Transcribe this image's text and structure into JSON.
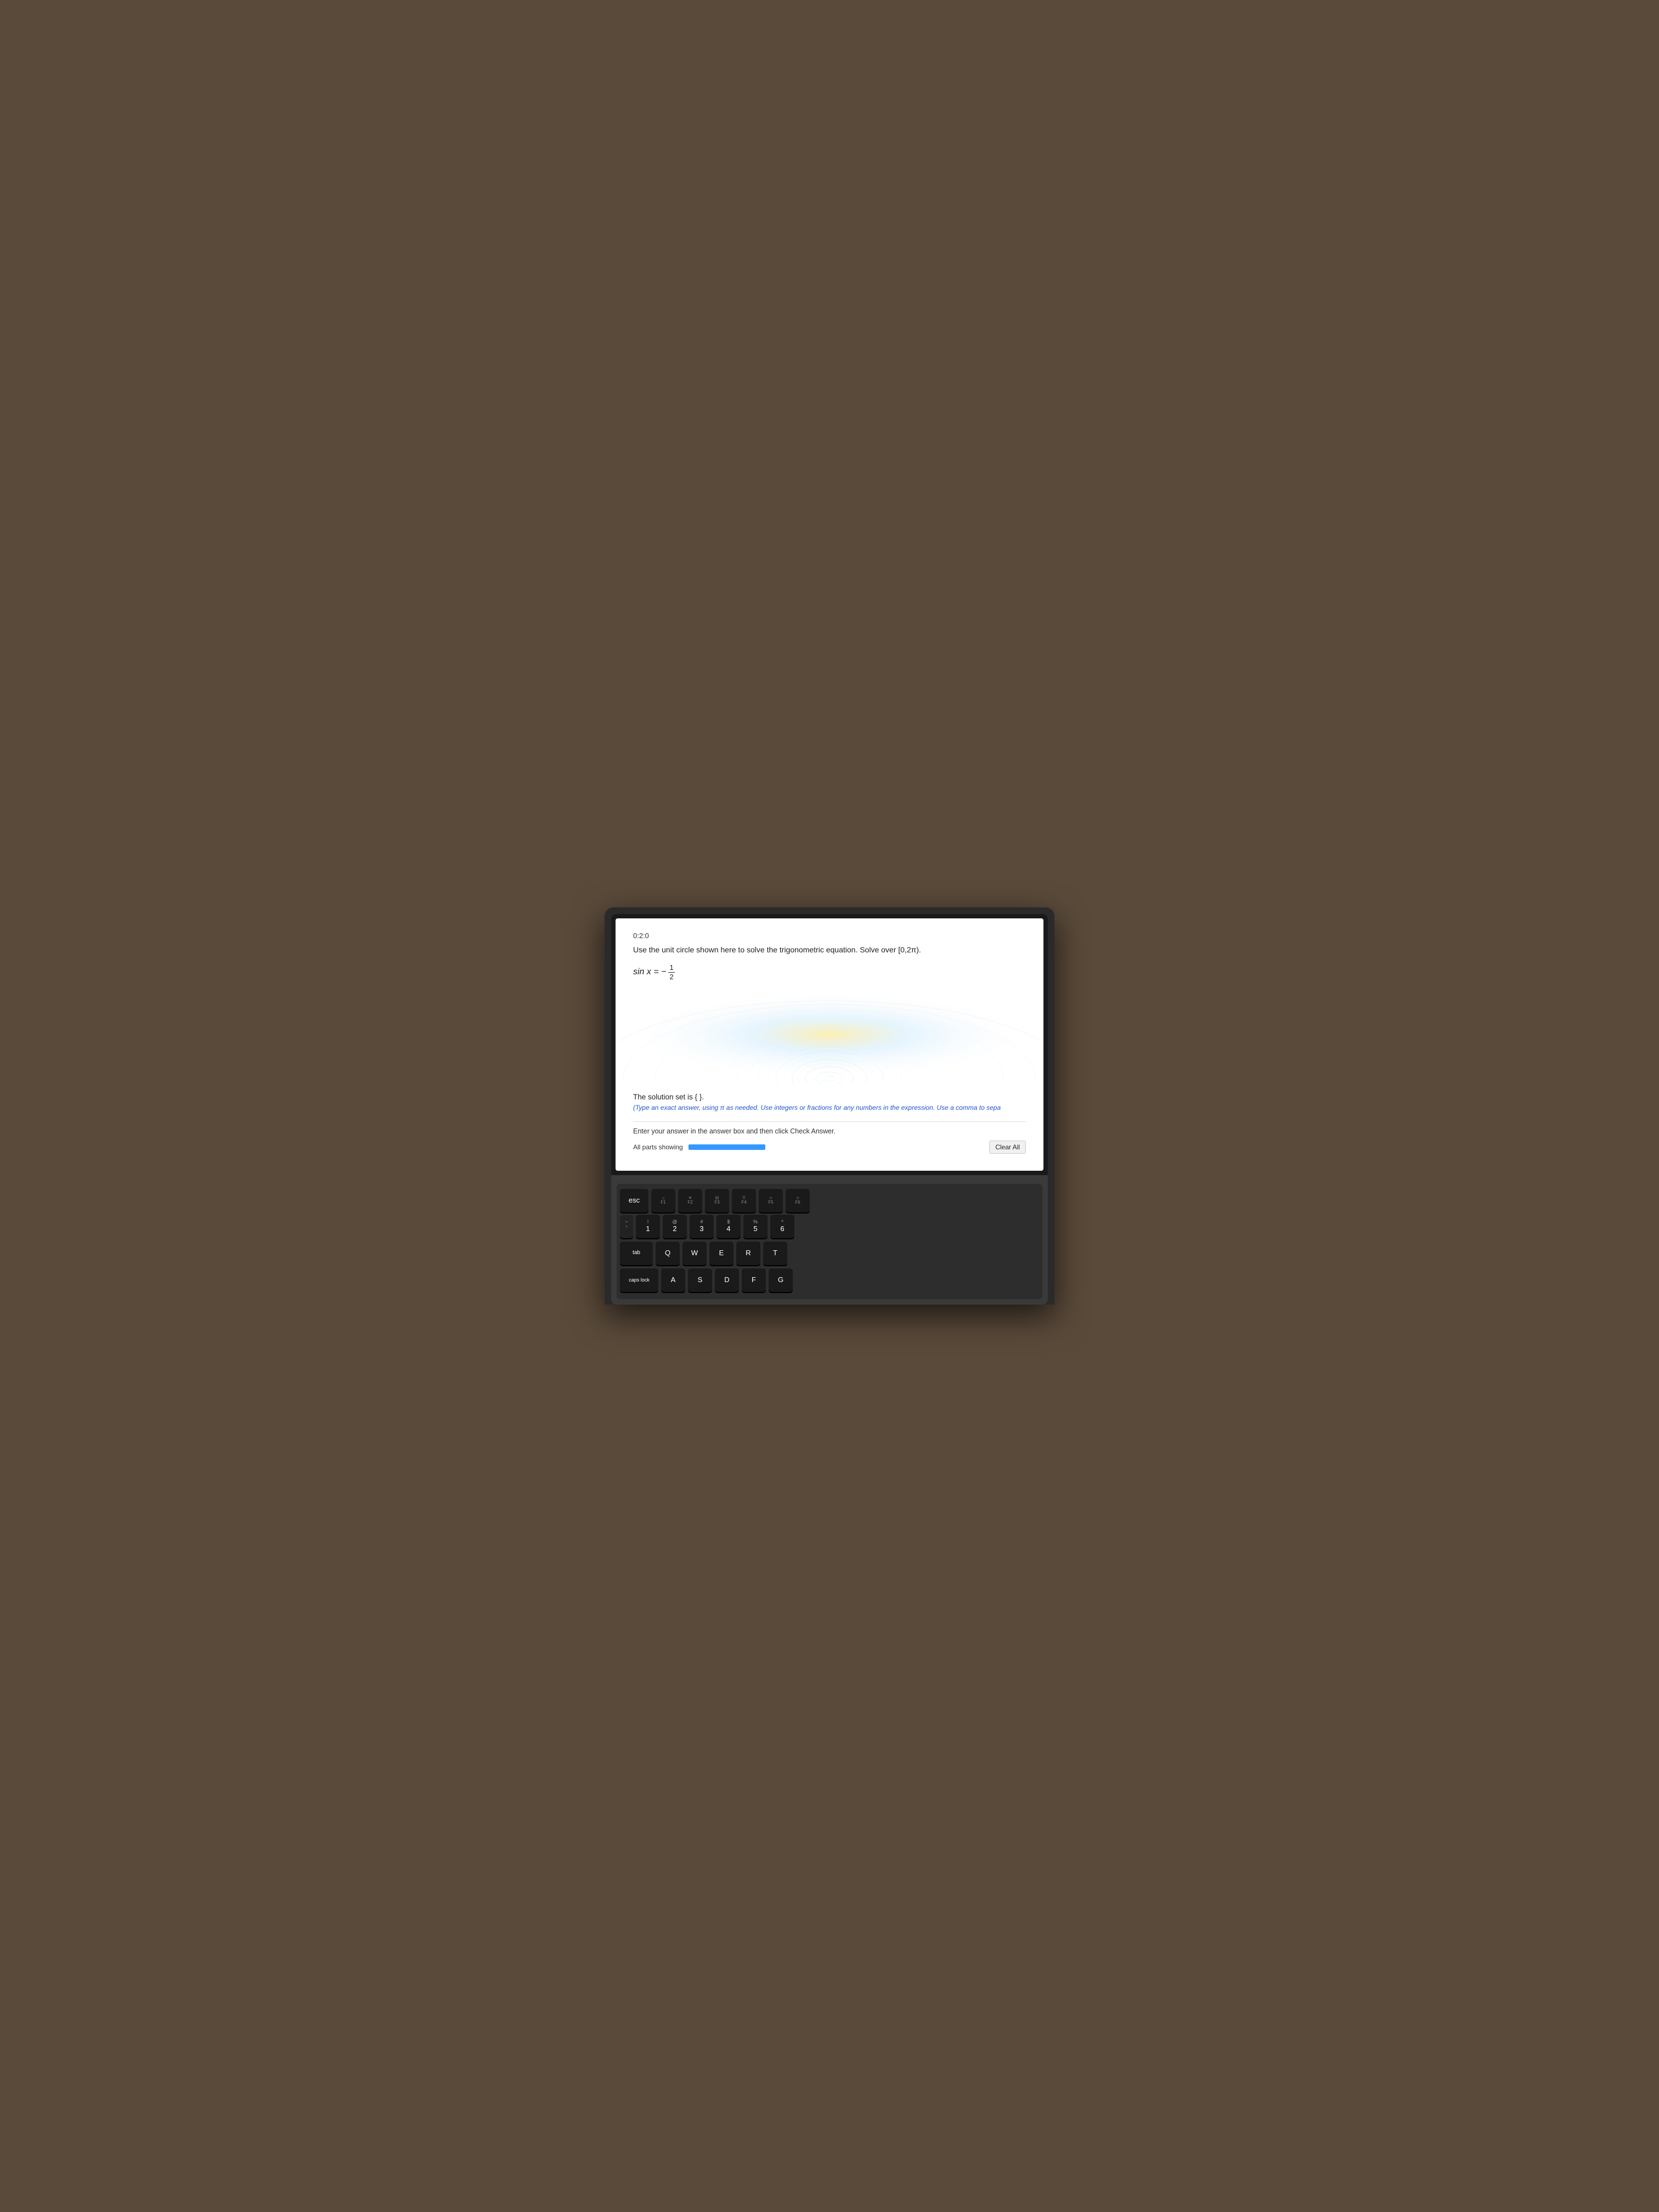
{
  "screen": {
    "problem_number": "0:2:0",
    "problem_text": "Use the unit circle shown here to solve the trigonometric equation. Solve over [0,2π).",
    "equation_prefix": "sin x = −",
    "equation_numerator": "1",
    "equation_denominator": "2",
    "solution_text": "The solution set is {    }.",
    "solution_instruction": "(Type an exact answer, using π as needed. Use integers or fractions for any numbers in the expression. Use a comma to sepa",
    "answer_instruction": "Enter your answer in the answer box and then click Check Answer.",
    "all_parts_label": "All parts showing",
    "clear_all_label": "Clear All"
  },
  "keyboard": {
    "fn_row": [
      {
        "label": "esc",
        "sub": ""
      },
      {
        "label": "F1",
        "sub": "☼"
      },
      {
        "label": "F2",
        "sub": "☀"
      },
      {
        "label": "F3",
        "sub": "⊞"
      },
      {
        "label": "F4",
        "sub": "⠿"
      },
      {
        "label": "F5",
        "sub": "⠶"
      },
      {
        "label": "F6",
        "sub": "⠶"
      }
    ],
    "number_row": [
      {
        "top": "~",
        "main": "`"
      },
      {
        "top": "!",
        "main": "1"
      },
      {
        "top": "@",
        "main": "2"
      },
      {
        "top": "#",
        "main": "3"
      },
      {
        "top": "$",
        "main": "4"
      },
      {
        "top": "%",
        "main": "5"
      },
      {
        "top": "^",
        "main": "6"
      }
    ],
    "qwerty_row": [
      "Q",
      "W",
      "E",
      "R",
      "T"
    ],
    "asdf_row": [
      "A",
      "S",
      "D",
      "F",
      "G"
    ],
    "specials": {
      "tab": "tab",
      "caps_lock": "caps lock"
    }
  }
}
